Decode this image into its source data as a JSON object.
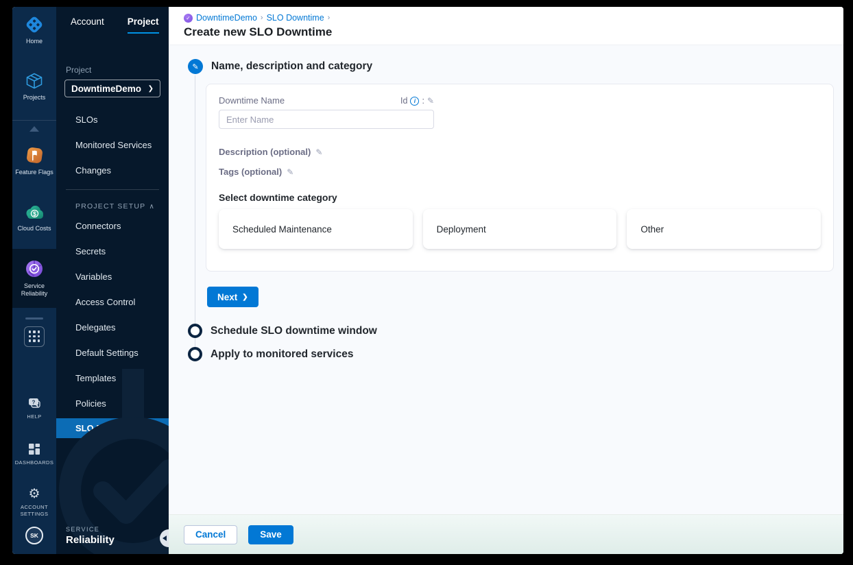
{
  "rail": {
    "home": {
      "label": "Home"
    },
    "projects": {
      "label": "Projects"
    },
    "feature_flags": {
      "label": "Feature Flags"
    },
    "cloud_costs": {
      "label": "Cloud Costs"
    },
    "service_reliability": {
      "label": "Service Reliability"
    },
    "help": {
      "label": "HELP"
    },
    "dashboards": {
      "label": "DASHBOARDS"
    },
    "account_settings": {
      "label": "ACCOUNT SETTINGS"
    },
    "avatar": "SK"
  },
  "sidebar": {
    "tabs": [
      {
        "label": "Account"
      },
      {
        "label": "Project"
      }
    ],
    "project_label": "Project",
    "project_name": "DowntimeDemo",
    "project_chevron": "❯",
    "nav_items": [
      "SLOs",
      "Monitored Services",
      "Changes"
    ],
    "section_title": "PROJECT SETUP",
    "section_caret": "∧",
    "setup_items": [
      "Connectors",
      "Secrets",
      "Variables",
      "Access Control",
      "Delegates",
      "Default Settings",
      "Templates",
      "Policies",
      "SLO Downtime"
    ],
    "footer_kicker": "SERVICE",
    "footer_title": "Reliability"
  },
  "main": {
    "breadcrumb": {
      "items": [
        "DowntimeDemo",
        "SLO Downtime"
      ],
      "separator": "›"
    },
    "title": "Create new SLO Downtime",
    "steps": [
      {
        "title": "Name, description and category"
      },
      {
        "title": "Schedule SLO downtime window"
      },
      {
        "title": "Apply to monitored services"
      }
    ],
    "form": {
      "name_label": "Downtime Name",
      "id_label": "Id",
      "id_colon": ":",
      "info_glyph": "i",
      "pencil_glyph": "✎",
      "name_placeholder": "Enter Name",
      "description_label": "Description (optional)",
      "tags_label": "Tags (optional)",
      "category_label": "Select downtime category",
      "categories": [
        "Scheduled Maintenance",
        "Deployment",
        "Other"
      ]
    },
    "next_label": "Next",
    "next_chevron": "❯",
    "footer": {
      "cancel": "Cancel",
      "save": "Save"
    }
  },
  "colors": {
    "primary_blue": "#0278d5",
    "rail_bg": "#0c2a4a",
    "sidebar_bg": "#06182b",
    "active_nav": "#0c6cb5",
    "tab_underline": "#0092e4",
    "content_bg": "#f8fafd",
    "step_ring": "#0b2441"
  }
}
